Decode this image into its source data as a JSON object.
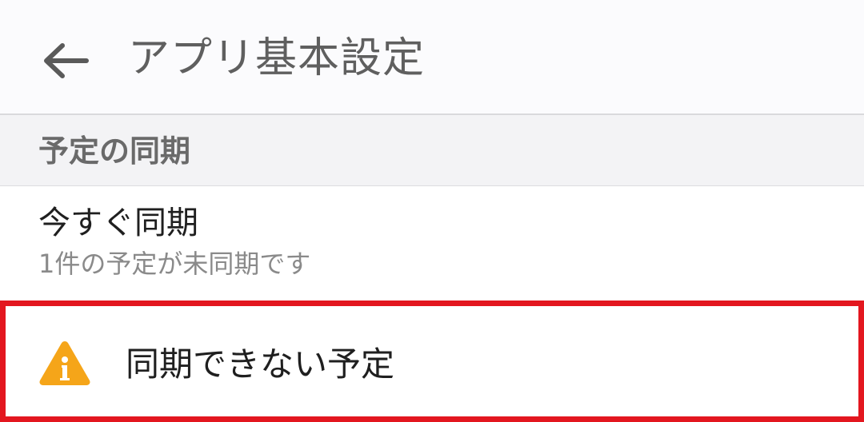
{
  "app_bar": {
    "back_icon": "arrow-left-icon",
    "title": "アプリ基本設定"
  },
  "section": {
    "title": "予定の同期"
  },
  "sync_now": {
    "title": "今すぐ同期",
    "subtitle": "1件の予定が未同期です"
  },
  "unsynced_events": {
    "icon": "warning-icon",
    "label": "同期できない予定"
  },
  "colors": {
    "highlight_border": "#e3171f",
    "warning": "#f5a519",
    "section_background": "#f3f3f5"
  }
}
